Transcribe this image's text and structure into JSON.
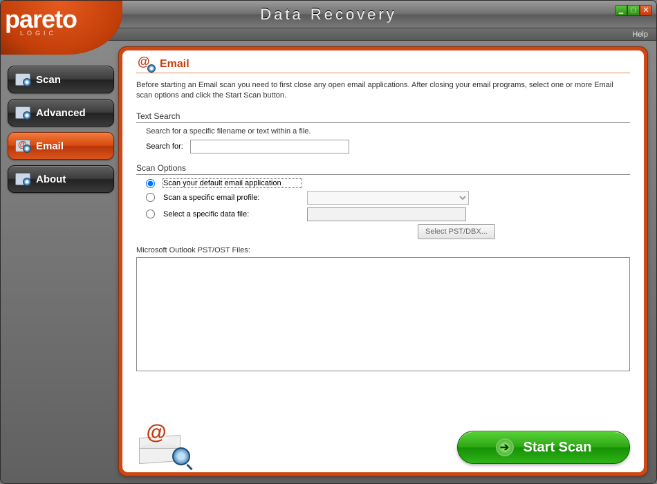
{
  "app": {
    "brand": "pareto",
    "brand_sub": "LOGIC",
    "title": "Data Recovery",
    "help_label": "Help"
  },
  "nav": {
    "items": [
      {
        "label": "Scan"
      },
      {
        "label": "Advanced"
      },
      {
        "label": "Email"
      },
      {
        "label": "About"
      }
    ],
    "active_index": 2
  },
  "panel": {
    "title": "Email",
    "intro": "Before starting an Email scan you need to first close any open email applications. After closing your email programs, select one or more Email scan options and click the Start Scan button."
  },
  "text_search": {
    "section_label": "Text Search",
    "hint": "Search for a specific filename or text within a file.",
    "search_for_label": "Search for:",
    "search_for_value": ""
  },
  "scan_options": {
    "section_label": "Scan Options",
    "opt1_label": "Scan your default email application",
    "opt2_label": "Scan a specific email profile:",
    "opt3_label": "Select a specific data file:",
    "profile_value": "",
    "datafile_value": "",
    "select_button_label": "Select PST/DBX...",
    "selected_option": "opt1"
  },
  "files": {
    "label": "Microsoft Outlook PST/OST Files:"
  },
  "actions": {
    "start_scan_label": "Start Scan"
  },
  "colors": {
    "accent_orange": "#cf4712",
    "accent_green": "#2fa716"
  }
}
